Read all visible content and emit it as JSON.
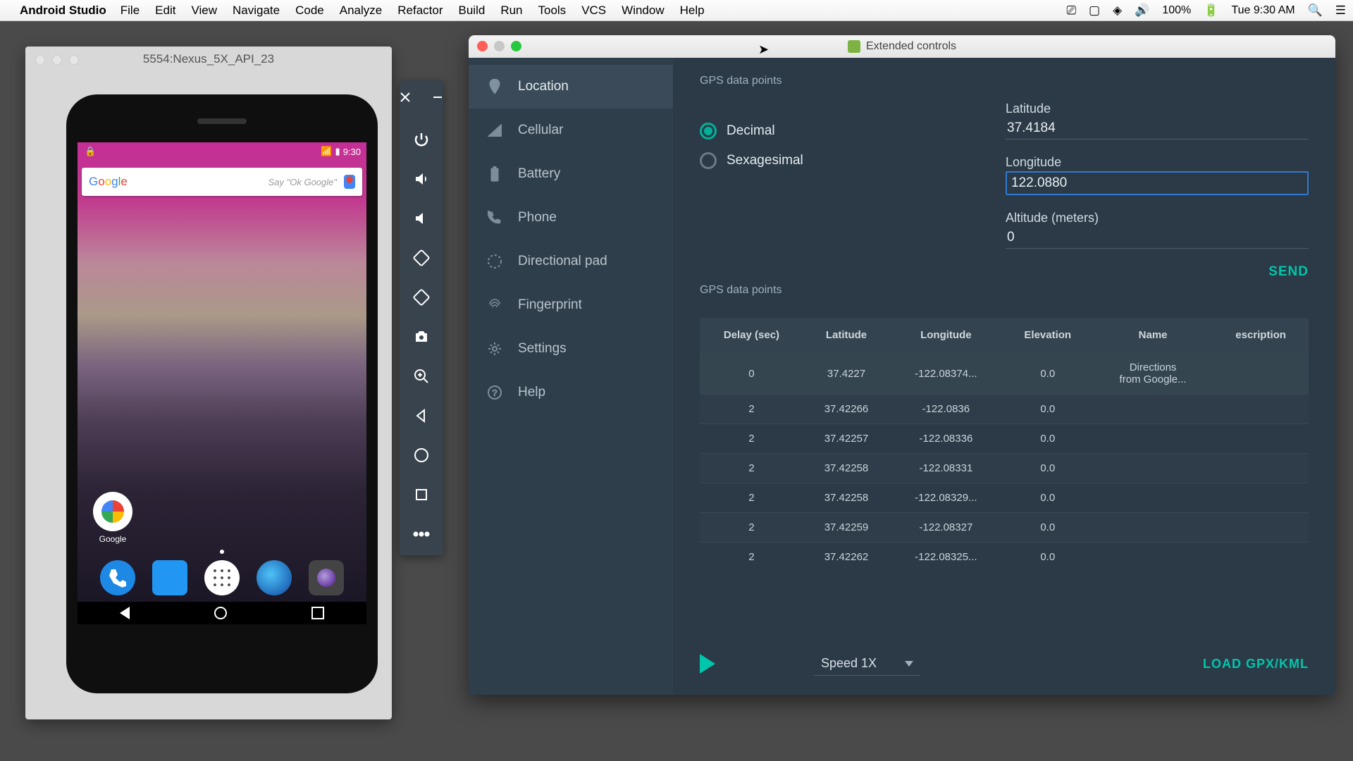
{
  "menubar": {
    "app": "Android Studio",
    "items": [
      "File",
      "Edit",
      "View",
      "Navigate",
      "Code",
      "Analyze",
      "Refactor",
      "Build",
      "Run",
      "Tools",
      "VCS",
      "Window",
      "Help"
    ],
    "battery": "100%",
    "clock": "Tue 9:30 AM"
  },
  "emulator": {
    "title": "5554:Nexus_5X_API_23",
    "status_time": "9:30",
    "search_say": "Say \"Ok Google\"",
    "google_folder": "Google"
  },
  "ext": {
    "title": "Extended controls",
    "nav": [
      "Location",
      "Cellular",
      "Battery",
      "Phone",
      "Directional pad",
      "Fingerprint",
      "Settings",
      "Help"
    ],
    "gps_header": "GPS data points",
    "radio_decimal": "Decimal",
    "radio_sexa": "Sexagesimal",
    "lat_label": "Latitude",
    "lat_value": "37.4184",
    "lon_label": "Longitude",
    "lon_value": "122.0880",
    "alt_label": "Altitude (meters)",
    "alt_value": "0",
    "send": "SEND",
    "table_headers": [
      "Delay (sec)",
      "Latitude",
      "Longitude",
      "Elevation",
      "Name",
      "escription"
    ],
    "rows": [
      {
        "delay": "0",
        "lat": "37.4227",
        "lon": "-122.08374...",
        "elev": "0.0",
        "name": "Directions\nfrom Google...",
        "desc": ""
      },
      {
        "delay": "2",
        "lat": "37.42266",
        "lon": "-122.0836",
        "elev": "0.0",
        "name": "",
        "desc": ""
      },
      {
        "delay": "2",
        "lat": "37.42257",
        "lon": "-122.08336",
        "elev": "0.0",
        "name": "",
        "desc": ""
      },
      {
        "delay": "2",
        "lat": "37.42258",
        "lon": "-122.08331",
        "elev": "0.0",
        "name": "",
        "desc": ""
      },
      {
        "delay": "2",
        "lat": "37.42258",
        "lon": "-122.08329...",
        "elev": "0.0",
        "name": "",
        "desc": ""
      },
      {
        "delay": "2",
        "lat": "37.42259",
        "lon": "-122.08327",
        "elev": "0.0",
        "name": "",
        "desc": ""
      },
      {
        "delay": "2",
        "lat": "37.42262",
        "lon": "-122.08325...",
        "elev": "0.0",
        "name": "",
        "desc": ""
      }
    ],
    "speed": "Speed 1X",
    "load": "LOAD GPX/KML"
  }
}
